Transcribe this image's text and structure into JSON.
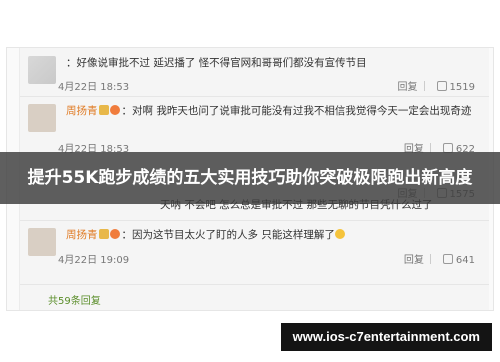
{
  "comments": [
    {
      "user": "",
      "text": "：好像说审批不过 延迟播了 怪不得官网和哥哥们都没有宣传节目",
      "time": "4月22日 18:53",
      "reply": "回复",
      "likes": "1519"
    },
    {
      "user": "周扬青",
      "text": "：对啊 我昨天也问了说审批可能没有过我不相信我觉得今天一定会出现奇迹",
      "time": "4月22日 18:53",
      "reply": "回复",
      "likes": "622"
    },
    {
      "user": "",
      "text": "天呐 不会吧 怎么总是审批不过 那些无聊的节目凭什么过了",
      "time": "",
      "reply": "回复",
      "likes": "1575"
    },
    {
      "user": "周扬青",
      "text": "：因为这节目太火了盯的人多 只能这样理解了",
      "time": "4月22日 19:09",
      "reply": "回复",
      "likes": "641"
    }
  ],
  "more_replies": "共59条回复",
  "banner": "提升55K跑步成绩的五大实用技巧助你突破极限跑出新高度",
  "watermark": "www.ios-c7entertainment.com",
  "colors": {
    "username": "#e07b24",
    "more": "#5b8e2b"
  }
}
